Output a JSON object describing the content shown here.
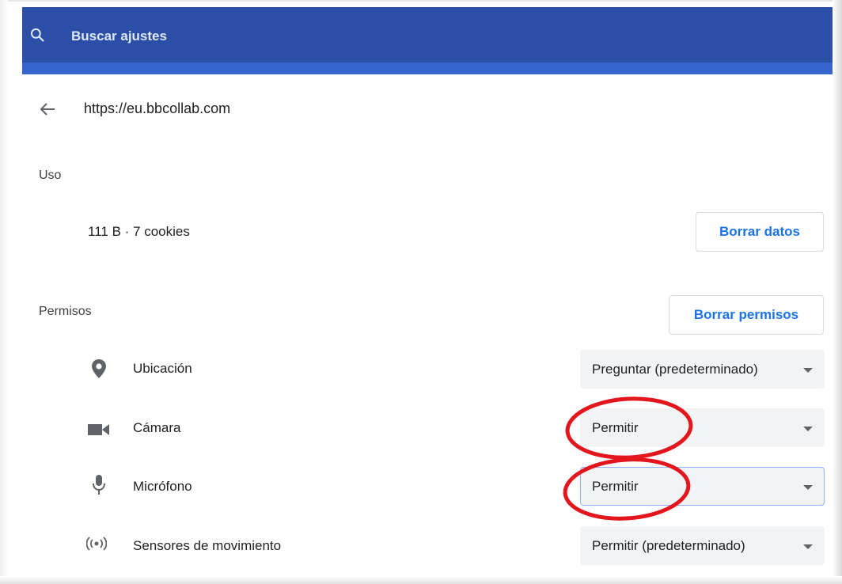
{
  "search": {
    "placeholder": "Buscar ajustes",
    "icon": "search-icon"
  },
  "site": {
    "url": "https://eu.bbcollab.com",
    "back_icon": "arrow-back-icon"
  },
  "usage": {
    "heading": "Uso",
    "summary": "111 B · 7 cookies",
    "clear_button": "Borrar datos"
  },
  "permissions": {
    "heading": "Permisos",
    "clear_button": "Borrar permisos",
    "items": [
      {
        "label": "Ubicación",
        "icon": "location-pin-icon",
        "value": "Preguntar (predeterminado)"
      },
      {
        "label": "Cámara",
        "icon": "camera-icon",
        "value": "Permitir"
      },
      {
        "label": "Micrófono",
        "icon": "microphone-icon",
        "value": "Permitir"
      },
      {
        "label": "Sensores de movimiento",
        "icon": "motion-sensors-icon",
        "value": "Permitir (predeterminado)"
      }
    ]
  },
  "colors": {
    "header": "#2b4fa6",
    "header_band": "#3666cc",
    "link_blue": "#1a73e8",
    "select_bg": "#f1f3f4",
    "annotation_red": "#e3161e"
  }
}
